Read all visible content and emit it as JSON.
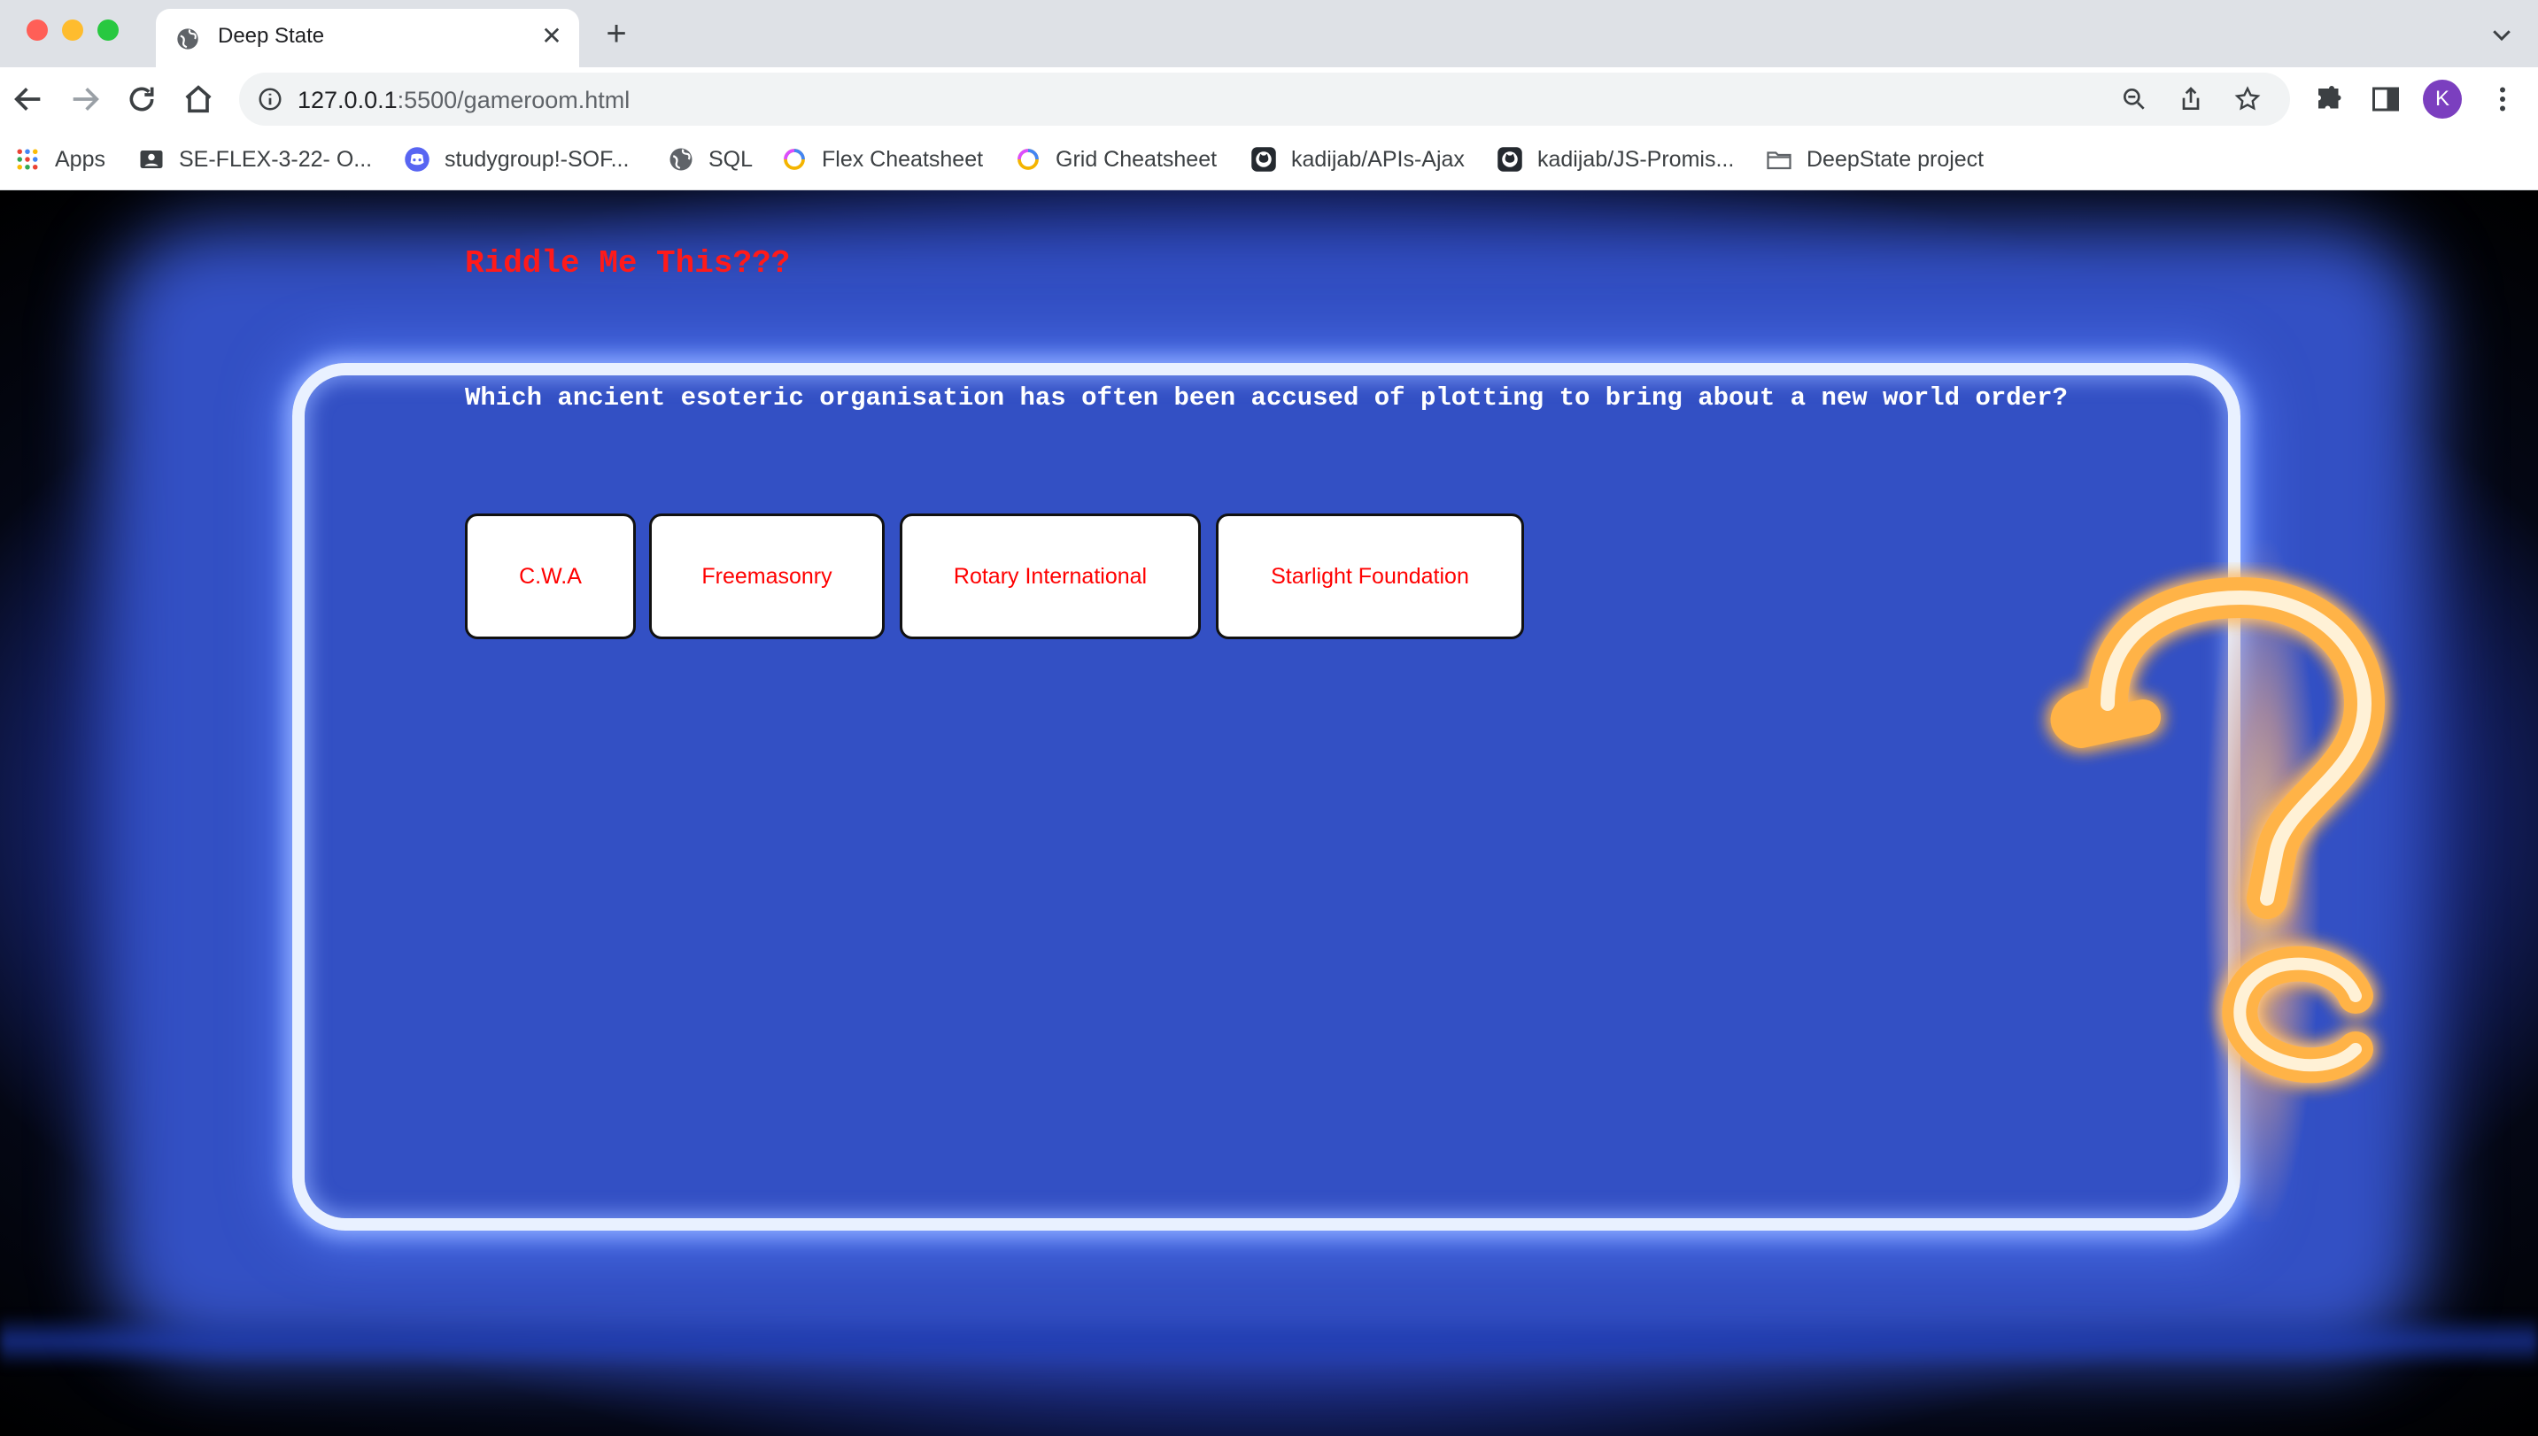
{
  "browser": {
    "tab_title": "Deep State",
    "url_host": "127.0.0.1",
    "url_rest": ":5500/gameroom.html",
    "profile_initial": "K"
  },
  "bookmarks": [
    {
      "label": "Apps",
      "icon": "apps-grid-icon"
    },
    {
      "label": "SE-FLEX-3-22- O...",
      "icon": "contact-card-icon"
    },
    {
      "label": "studygroup!-SOF...",
      "icon": "discord-icon"
    },
    {
      "label": "SQL",
      "icon": "globe-icon"
    },
    {
      "label": "Flex Cheatsheet",
      "icon": "ring-icon"
    },
    {
      "label": "Grid Cheatsheet",
      "icon": "ring-icon"
    },
    {
      "label": "kadijab/APIs-Ajax",
      "icon": "github-icon"
    },
    {
      "label": "kadijab/JS-Promis...",
      "icon": "github-icon"
    },
    {
      "label": "DeepState project",
      "icon": "folder-icon"
    }
  ],
  "game": {
    "title": "Riddle Me This???",
    "question": "Which ancient esoteric organisation has often been accused of plotting to bring about a new world order?",
    "answers": [
      "C.W.A",
      "Freemasonry",
      "Rotary International",
      "Starlight Foundation"
    ]
  },
  "colors": {
    "title_red": "#ff1a1a",
    "answer_text": "#ff0000",
    "neon_blue": "#3350c4",
    "neon_orange": "#ffb347"
  }
}
